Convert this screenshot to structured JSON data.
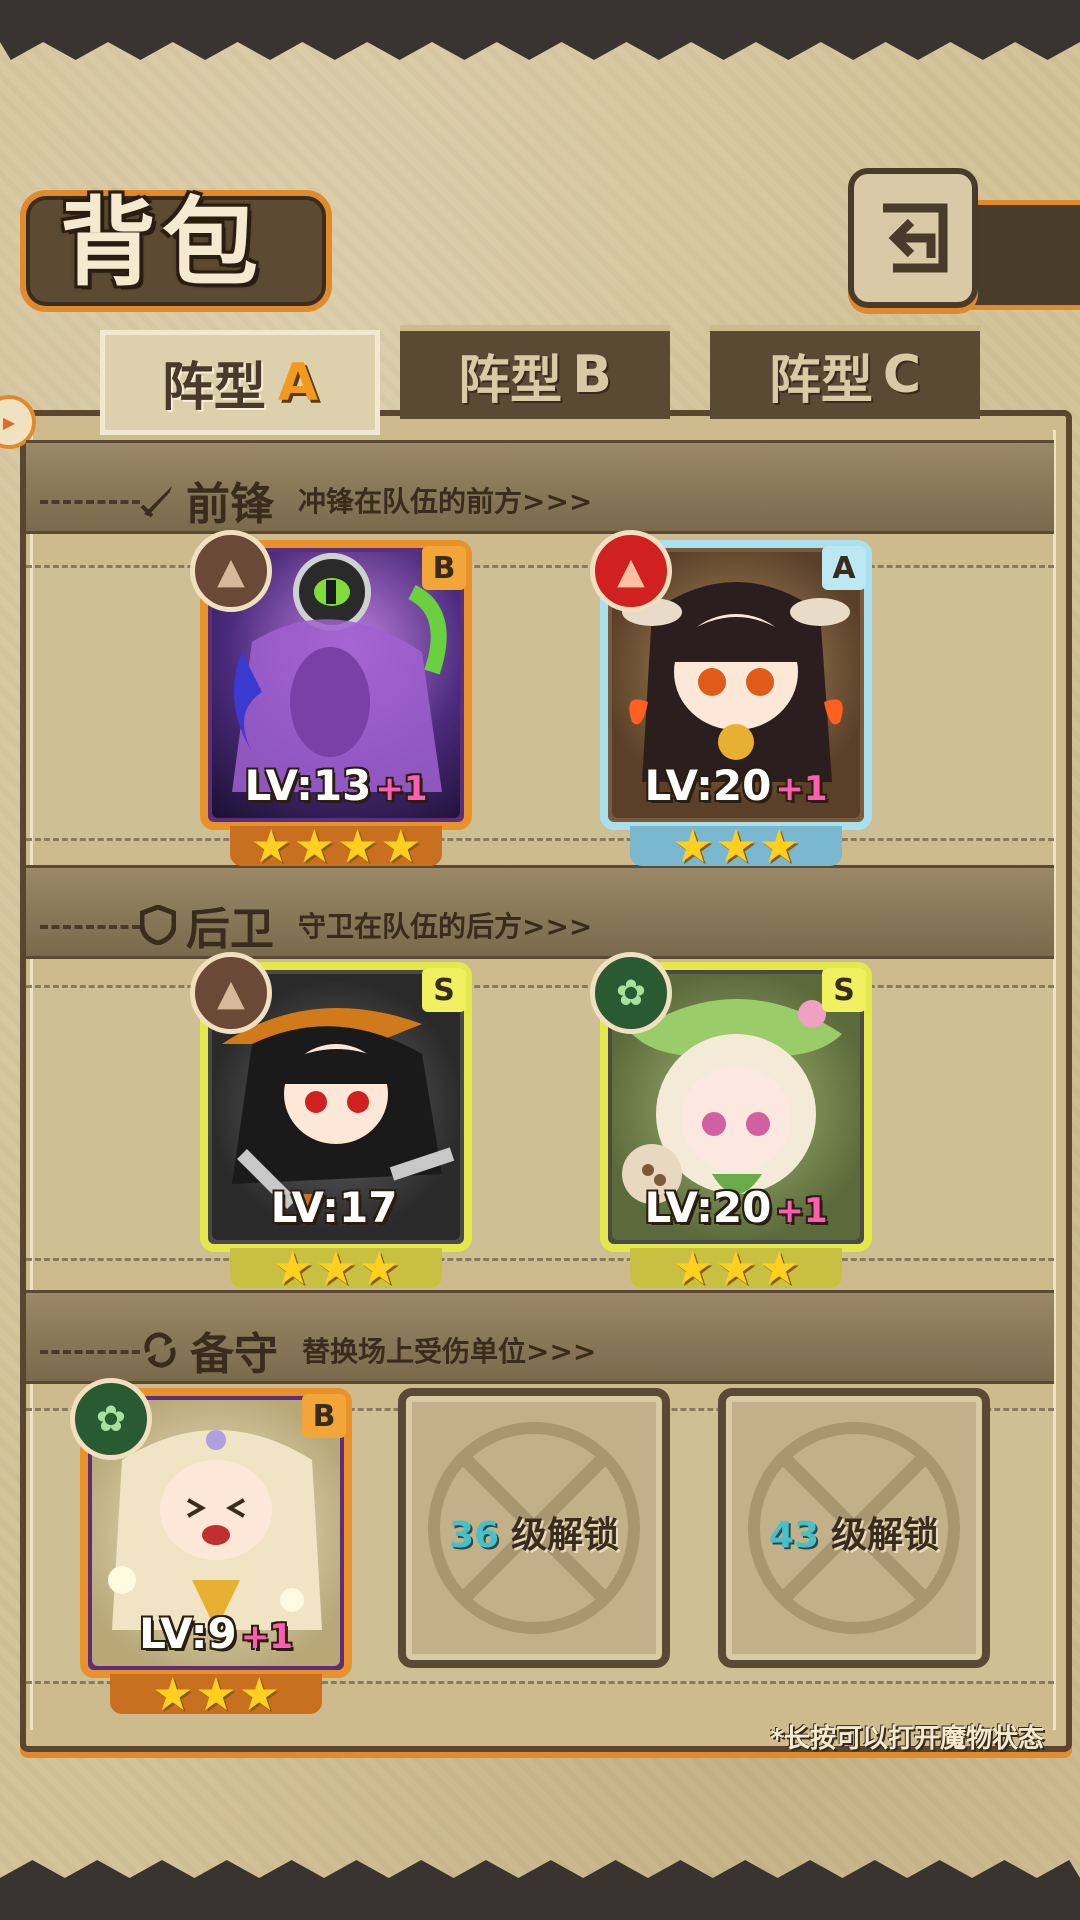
{
  "header": {
    "title": "背包"
  },
  "tabs": [
    {
      "label": "阵型",
      "suffix": "A",
      "active": true
    },
    {
      "label": "阵型",
      "suffix": "B",
      "active": false
    },
    {
      "label": "阵型",
      "suffix": "C",
      "active": false
    }
  ],
  "sections": {
    "front": {
      "name": "前锋",
      "desc": "冲锋在队伍的前方>>>",
      "icon": "sword-icon"
    },
    "rear": {
      "name": "后卫",
      "desc": "守卫在队伍的后方>>>",
      "icon": "shield-icon"
    },
    "reserve": {
      "name": "备守",
      "desc": "替换场上受伤单位>>>",
      "icon": "swap-icon"
    }
  },
  "cards": [
    {
      "id": "front1",
      "rank": "B",
      "element": "earth",
      "level": "LV:13",
      "bonus": "+1",
      "stars": 4
    },
    {
      "id": "front2",
      "rank": "A",
      "element": "fire",
      "level": "LV:20",
      "bonus": "+1",
      "stars": 3
    },
    {
      "id": "rear1",
      "rank": "S",
      "element": "earth",
      "level": "LV:17",
      "bonus": "",
      "stars": 3
    },
    {
      "id": "rear2",
      "rank": "S",
      "element": "leaf",
      "level": "LV:20",
      "bonus": "+1",
      "stars": 3
    },
    {
      "id": "reserve1",
      "rank": "B",
      "element": "leaf",
      "level": "LV:9",
      "bonus": "+1",
      "stars": 3
    }
  ],
  "locked_slots": [
    {
      "level": "36",
      "label": "级解锁"
    },
    {
      "level": "43",
      "label": "级解锁"
    }
  ],
  "hint": "*长按可以打开魔物状态",
  "colors": {
    "accent": "#e08a2c",
    "rankB": "#e9922a",
    "rankA": "#a8e0f0",
    "rankS": "#e4e84a",
    "plus": "#ff5fb0",
    "unlockNum": "#48c0c8"
  }
}
